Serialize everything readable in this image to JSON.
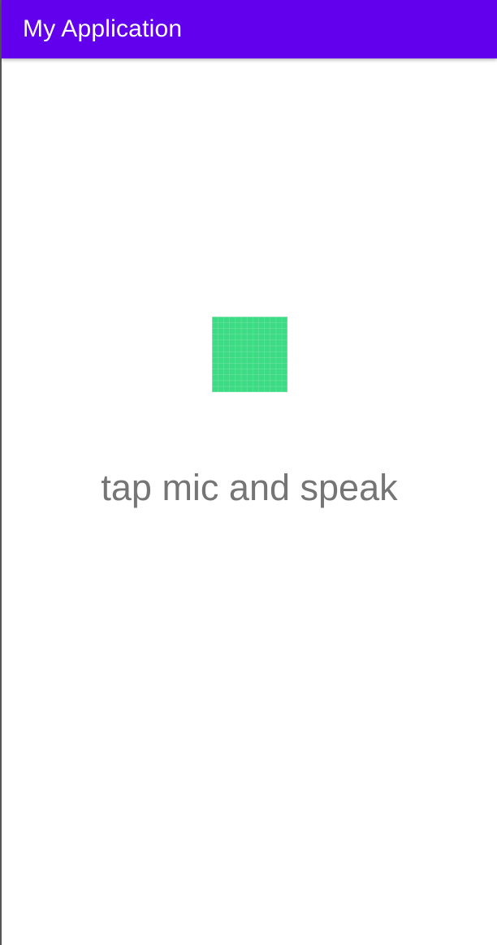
{
  "app_bar": {
    "title": "My Application",
    "background_color": "#6200ee",
    "title_color": "#ffffff"
  },
  "main": {
    "mic_button": {
      "icon": "mic-icon",
      "color": "#3ddc84"
    },
    "prompt_text": "tap mic and speak",
    "prompt_color": "#757575"
  }
}
